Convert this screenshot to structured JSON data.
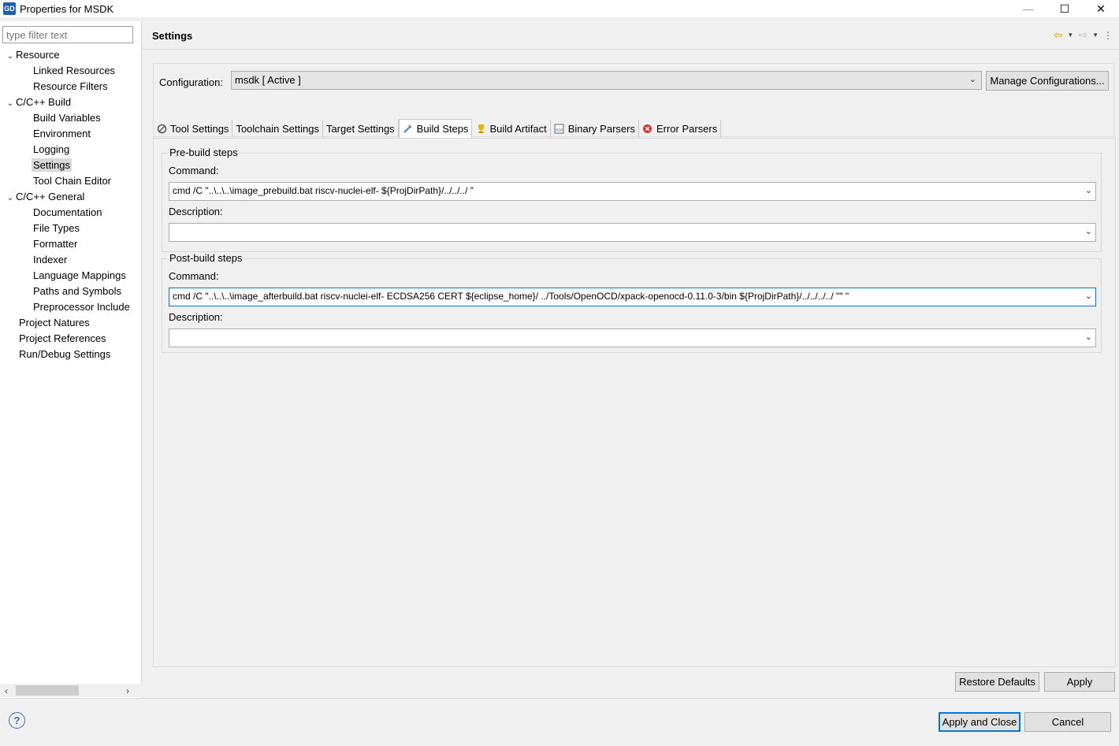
{
  "window": {
    "title": "Properties for MSDK",
    "app_icon_text": "GD",
    "minimize": "—",
    "maximize": "☐",
    "close": "✕"
  },
  "filter": {
    "placeholder": "type filter text"
  },
  "tree": {
    "resource": "Resource",
    "linked_resources": "Linked Resources",
    "resource_filters": "Resource Filters",
    "cpp_build": "C/C++ Build",
    "build_variables": "Build Variables",
    "environment": "Environment",
    "logging": "Logging",
    "settings": "Settings",
    "tool_chain_editor": "Tool Chain Editor",
    "cpp_general": "C/C++ General",
    "documentation": "Documentation",
    "file_types": "File Types",
    "formatter": "Formatter",
    "indexer": "Indexer",
    "language_mappings": "Language Mappings",
    "paths_and_symbols": "Paths and Symbols",
    "preprocessor_include": "Preprocessor Include",
    "project_natures": "Project Natures",
    "project_references": "Project References",
    "run_debug_settings": "Run/Debug Settings",
    "selected": "Settings"
  },
  "page": {
    "title": "Settings"
  },
  "configuration": {
    "label": "Configuration:",
    "value": "msdk  [ Active ]",
    "manage_button": "Manage Configurations..."
  },
  "tabs": {
    "tool_settings": "Tool Settings",
    "toolchain_settings": "Toolchain Settings",
    "target_settings": "Target Settings",
    "build_steps": "Build Steps",
    "build_artifact": "Build Artifact",
    "binary_parsers": "Binary Parsers",
    "error_parsers": "Error Parsers",
    "active": "Build Steps"
  },
  "pre_build": {
    "title": "Pre-build steps",
    "command_label": "Command:",
    "command_value": "cmd /C \"..\\..\\..\\image_prebuild.bat riscv-nuclei-elf- ${ProjDirPath}/../../../ \"",
    "description_label": "Description:",
    "description_value": ""
  },
  "post_build": {
    "title": "Post-build steps",
    "command_label": "Command:",
    "command_value": "cmd /C \"..\\..\\..\\image_afterbuild.bat riscv-nuclei-elf-  ECDSA256 CERT ${eclipse_home}/   ../Tools/OpenOCD/xpack-openocd-0.11.0-3/bin ${ProjDirPath}/../../../../ \"\" \"",
    "description_label": "Description:",
    "description_value": ""
  },
  "buttons": {
    "restore_defaults": "Restore Defaults",
    "apply": "Apply",
    "apply_and_close": "Apply and Close",
    "cancel": "Cancel"
  },
  "colors": {
    "accent": "#0078d7",
    "app_icon": "#1d5fb4",
    "nav_arrow": "#d8a000"
  }
}
